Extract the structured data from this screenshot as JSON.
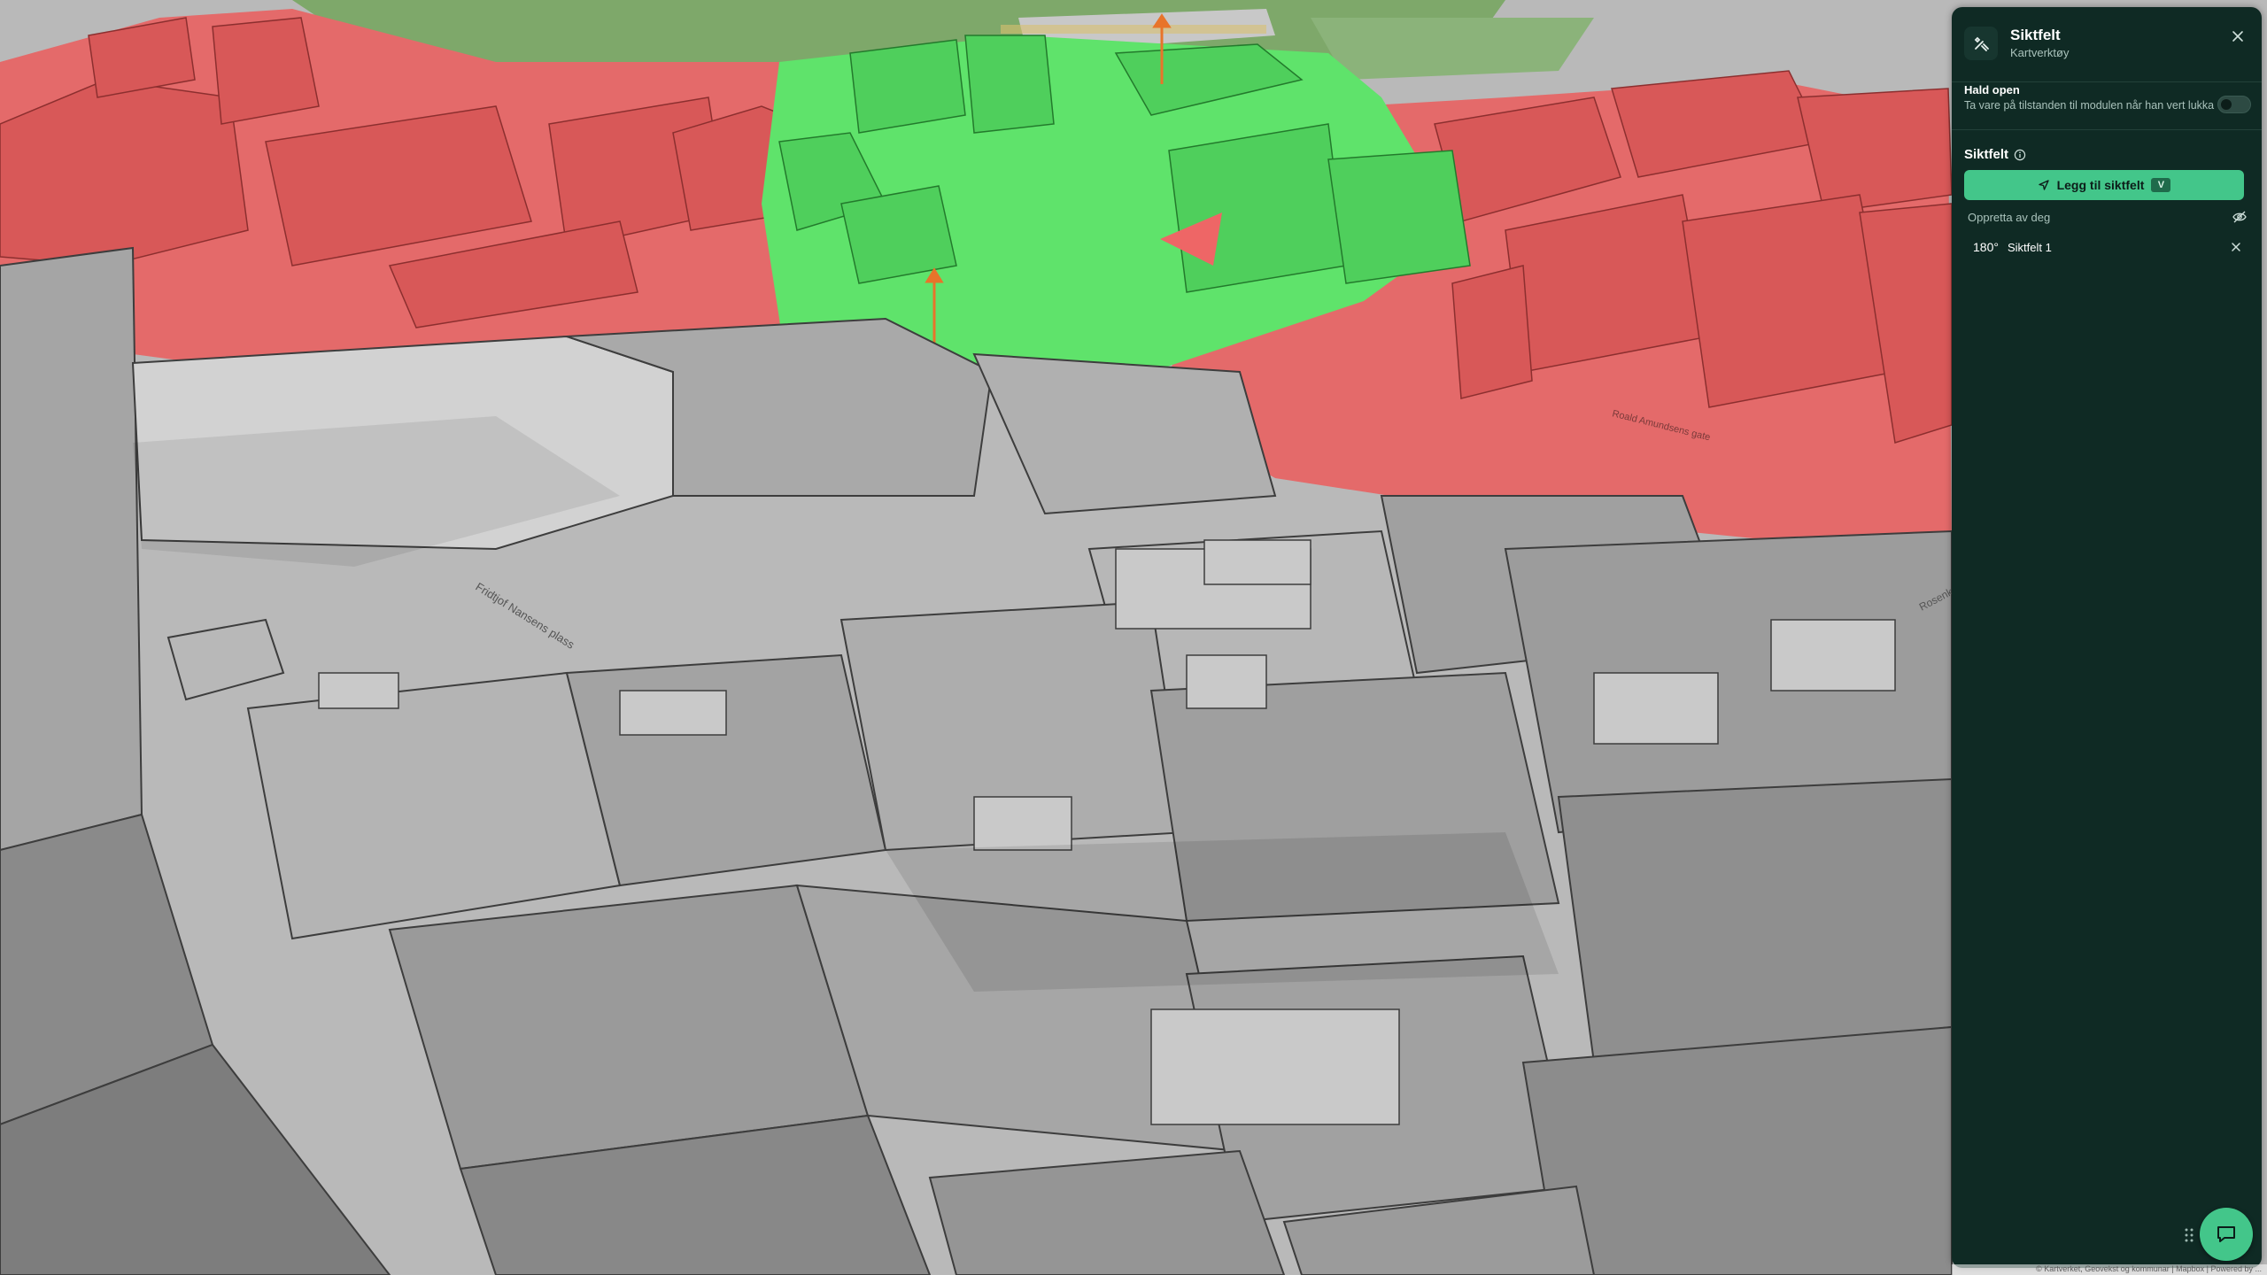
{
  "panel": {
    "title": "Siktfelt",
    "subtitle": "Kartverktøy",
    "keep_open": {
      "title": "Hald open",
      "description": "Ta vare på tilstanden til modulen når han vert lukka",
      "enabled": false
    },
    "section_title": "Siktfelt",
    "add_button": {
      "label": "Legg til siktfelt",
      "shortcut": "V"
    },
    "created_by_label": "Oppretta av deg",
    "items": [
      {
        "angle": "180°",
        "name": "Siktfelt 1"
      }
    ]
  },
  "map": {
    "street_labels": [
      "Fridtjof Nansens plass",
      "Roald Amundsens gate",
      "Rosenkrantz"
    ],
    "attribution": "© Kartverket, Geovekst og kommunar | Mapbox | Powered by ..."
  },
  "colors": {
    "panel_bg": "#0f2a24",
    "accent_green": "#43c68a",
    "visible_area": "#5fe36b",
    "hidden_area": "#ee6666",
    "building_gray": "#9a9a9a"
  }
}
